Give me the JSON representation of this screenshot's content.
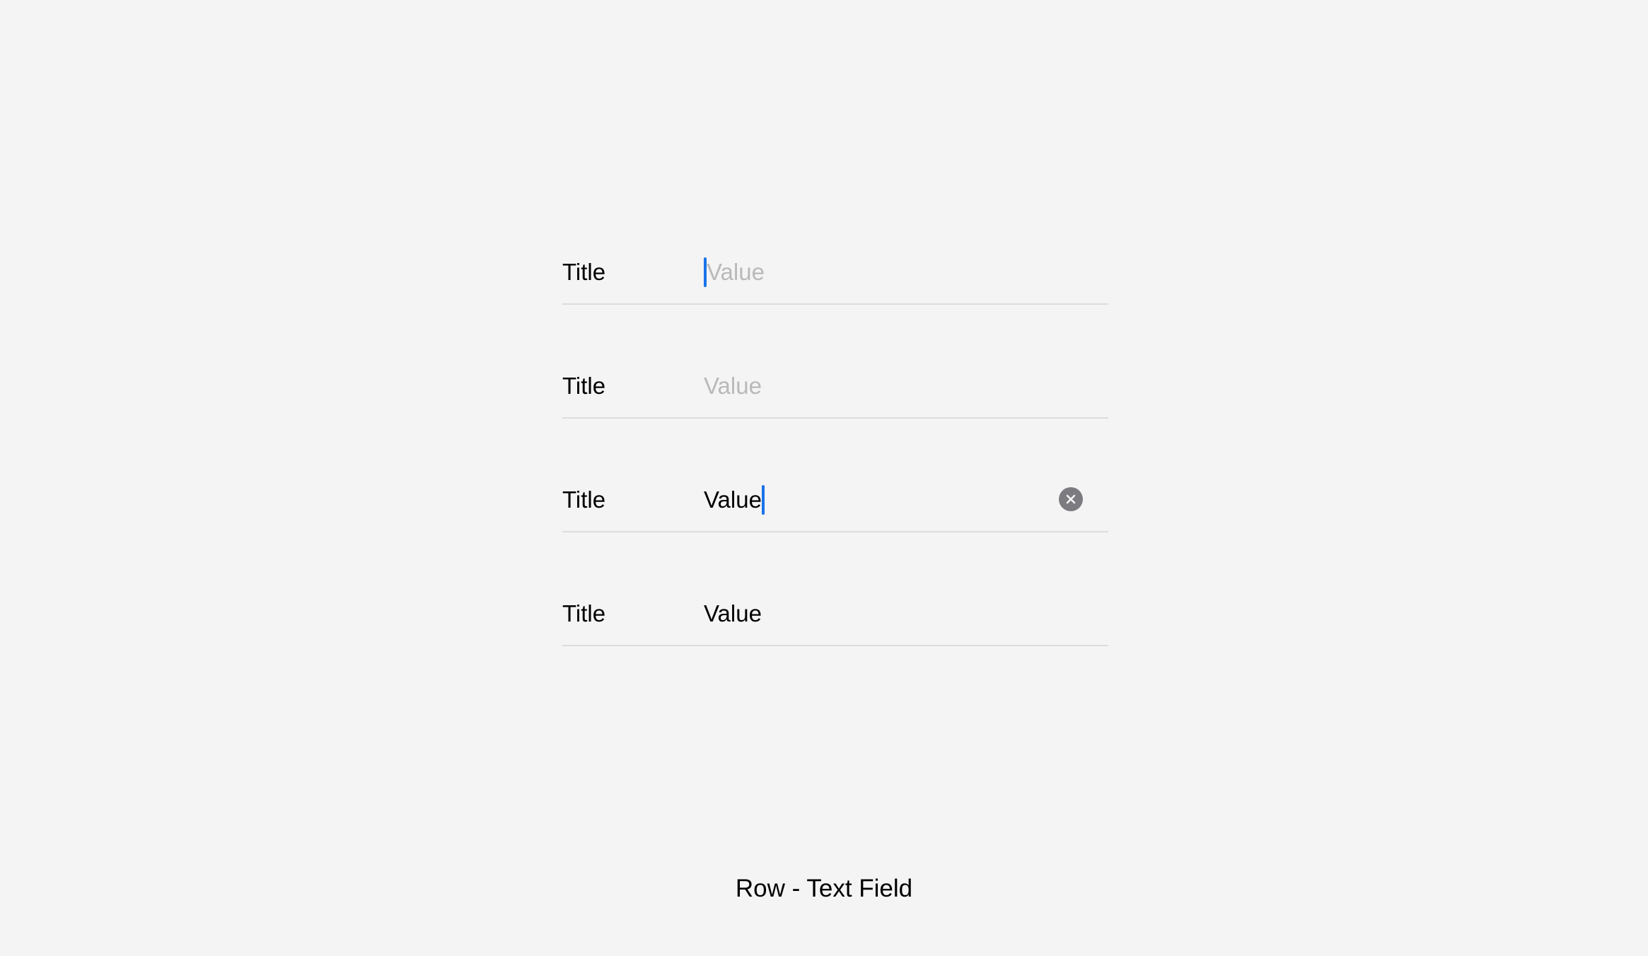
{
  "rows": [
    {
      "title": "Title",
      "placeholder": "Value",
      "value": "",
      "state": "focused-empty"
    },
    {
      "title": "Title",
      "placeholder": "Value",
      "value": "",
      "state": "empty"
    },
    {
      "title": "Title",
      "placeholder": "Value",
      "value": "Value",
      "state": "focused-filled"
    },
    {
      "title": "Title",
      "placeholder": "Value",
      "value": "Value",
      "state": "filled"
    }
  ],
  "caption": "Row - Text Field",
  "icons": {
    "clear": "clear-circle-icon"
  },
  "colors": {
    "background": "#f4f4f4",
    "caret": "#1a73e8",
    "placeholder": "#b9b9b9",
    "text": "#000000",
    "divider": "#dcdcdc",
    "clear_button": "#7c7c80"
  }
}
